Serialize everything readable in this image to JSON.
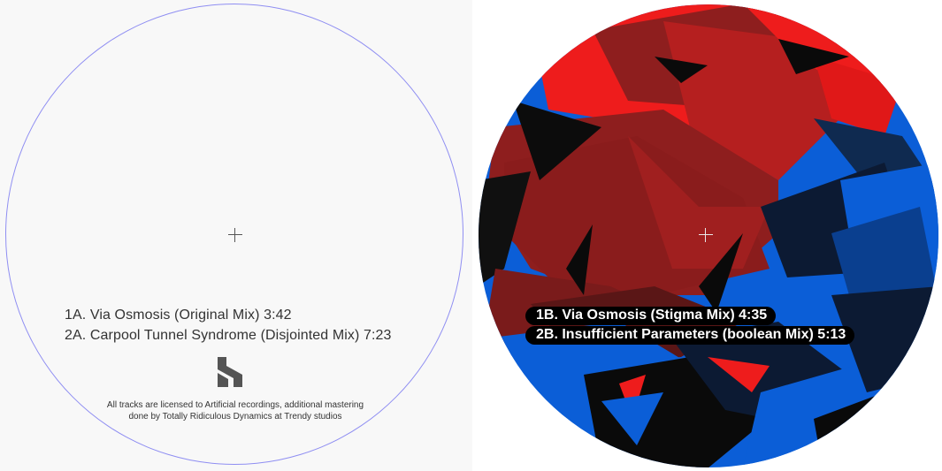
{
  "side_a": {
    "tracks": [
      "1A. Via Osmosis (Original Mix) 3:42",
      "2A. Carpool Tunnel Syndrome (Disjointed Mix) 7:23"
    ],
    "credits_line1": "All tracks are licensed to Artificial recordings, additional mastering",
    "credits_line2": "done by Totally Ridiculous Dynamics at Trendy studios",
    "outline_color": "#8f8ef2",
    "logo_icon": "label-logo-icon"
  },
  "side_b": {
    "tracks": [
      "1B. Via Osmosis (Stigma Mix) 4:35",
      "2B. Insufficient Parameters (boolean Mix) 5:13"
    ],
    "art_colors": {
      "red": "#ee1c1c",
      "dark_red": "#8e1e1e",
      "blue": "#0b5ed7",
      "navy": "#0c1a33",
      "black": "#0a0a0a"
    }
  }
}
